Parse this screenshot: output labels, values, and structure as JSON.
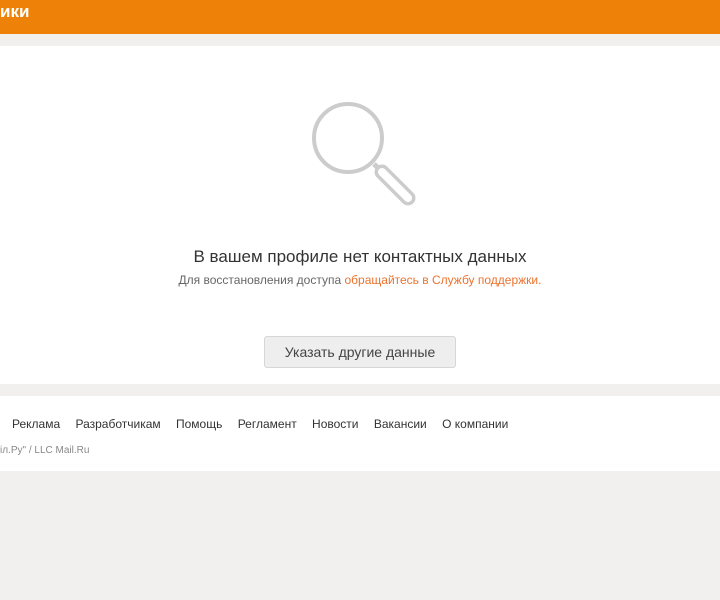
{
  "header": {
    "title": "ики"
  },
  "icons": {
    "empty_state": "search-icon"
  },
  "empty_state": {
    "heading": "В вашем профиле нет контактных данных",
    "message_prefix": "Для восстановления доступа ",
    "support_link": "обращайтесь в Службу поддержки."
  },
  "actions": {
    "other_data_label": "Указать другие данные"
  },
  "footer": {
    "links": [
      "Реклама",
      "Разработчикам",
      "Помощь",
      "Регламент",
      "Новости",
      "Вакансии",
      "О компании"
    ],
    "copyright": "іл.Ру\" / LLC Mail.Ru"
  },
  "colors": {
    "brand": "#ee8208",
    "link": "#eb722e",
    "page_bg": "#f1f0ef"
  }
}
